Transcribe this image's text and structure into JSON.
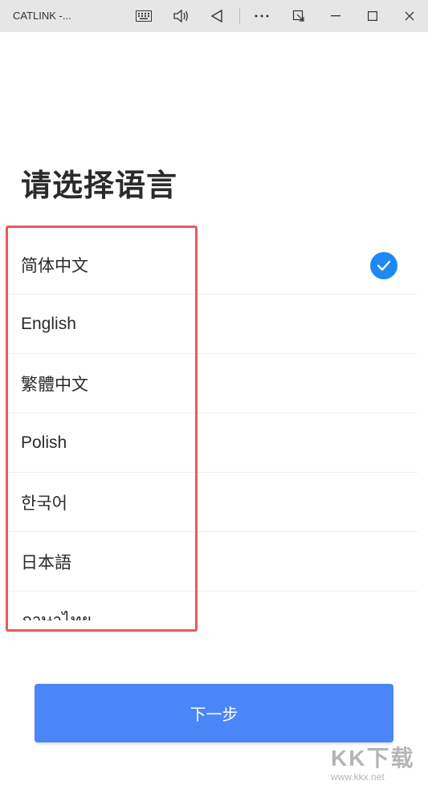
{
  "window": {
    "title": "CATLINK -...",
    "buttons": [
      "keyboard-icon",
      "volume-icon",
      "back-icon",
      "more-icon",
      "snap-icon",
      "minimize-icon",
      "maximize-icon",
      "close-icon"
    ]
  },
  "page": {
    "title": "请选择语言"
  },
  "languages": [
    {
      "label": "简体中文",
      "selected": true
    },
    {
      "label": "English",
      "selected": false
    },
    {
      "label": "繁體中文",
      "selected": false
    },
    {
      "label": "Polish",
      "selected": false
    },
    {
      "label": "한국어",
      "selected": false
    },
    {
      "label": "日本語",
      "selected": false
    },
    {
      "label": "ภาษาไทย",
      "selected": false
    }
  ],
  "next_button": {
    "label": "下一步"
  },
  "watermark": {
    "big": "KK下载",
    "small": "www.kkx.net"
  },
  "colors": {
    "accent": "#4a86f7",
    "check": "#1e88f5",
    "highlight": "#e85a5a"
  }
}
